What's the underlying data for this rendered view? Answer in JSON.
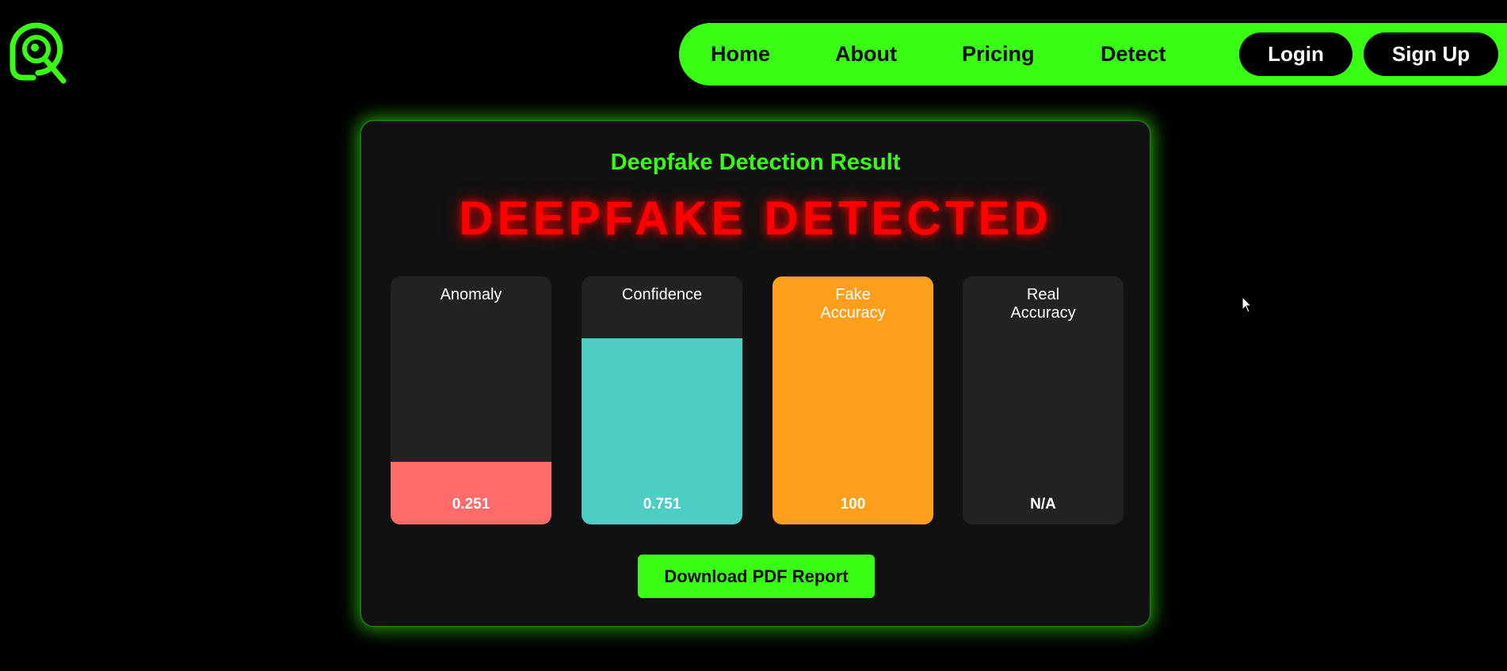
{
  "brand": {
    "logo_icon": "magnifier-eye-logo",
    "accent_color": "#39ff14"
  },
  "nav": {
    "links": [
      {
        "label": "Home"
      },
      {
        "label": "About"
      },
      {
        "label": "Pricing"
      },
      {
        "label": "Detect"
      }
    ],
    "login_label": "Login",
    "signup_label": "Sign Up"
  },
  "result": {
    "title": "Deepfake Detection Result",
    "verdict": "DEEPFAKE DETECTED",
    "verdict_color": "#ff0000",
    "metrics": [
      {
        "label": "Anomaly",
        "value": "0.251",
        "fill_fraction": 0.251,
        "color": "#ff6b6b"
      },
      {
        "label": "Confidence",
        "value": "0.751",
        "fill_fraction": 0.751,
        "color": "#4ecdc4"
      },
      {
        "label": "Fake\nAccuracy",
        "value": "100",
        "fill_fraction": 1.0,
        "color": "#ff9f1c"
      },
      {
        "label": "Real\nAccuracy",
        "value": "N/A",
        "fill_fraction": 0,
        "color": "#222222"
      }
    ],
    "download_label": "Download PDF Report"
  }
}
